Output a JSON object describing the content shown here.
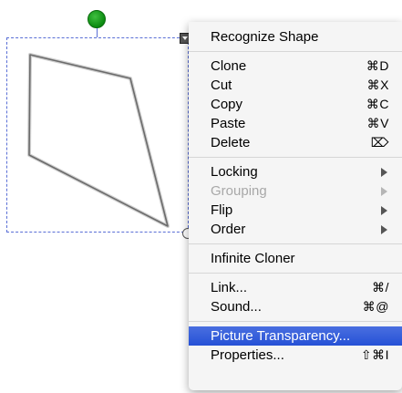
{
  "colors": {
    "selection_border": "#5a6fd6",
    "rotate_handle": "#0b8a10",
    "highlight": "#2d5bd9",
    "menu_background": "#f5f5f5"
  },
  "canvas": {
    "shape_type": "quadrilateral"
  },
  "menu": {
    "groups": [
      [
        {
          "label": "Recognize Shape",
          "shortcut": "",
          "submenu": false,
          "disabled": false,
          "highlighted": false
        }
      ],
      [
        {
          "label": "Clone",
          "shortcut": "⌘D",
          "submenu": false,
          "disabled": false,
          "highlighted": false
        },
        {
          "label": "Cut",
          "shortcut": "⌘X",
          "submenu": false,
          "disabled": false,
          "highlighted": false
        },
        {
          "label": "Copy",
          "shortcut": "⌘C",
          "submenu": false,
          "disabled": false,
          "highlighted": false
        },
        {
          "label": "Paste",
          "shortcut": "⌘V",
          "submenu": false,
          "disabled": false,
          "highlighted": false
        },
        {
          "label": "Delete",
          "shortcut": "⌦",
          "submenu": false,
          "disabled": false,
          "highlighted": false
        }
      ],
      [
        {
          "label": "Locking",
          "shortcut": "",
          "submenu": true,
          "disabled": false,
          "highlighted": false
        },
        {
          "label": "Grouping",
          "shortcut": "",
          "submenu": true,
          "disabled": true,
          "highlighted": false
        },
        {
          "label": "Flip",
          "shortcut": "",
          "submenu": true,
          "disabled": false,
          "highlighted": false
        },
        {
          "label": "Order",
          "shortcut": "",
          "submenu": true,
          "disabled": false,
          "highlighted": false
        }
      ],
      [
        {
          "label": "Infinite Cloner",
          "shortcut": "",
          "submenu": false,
          "disabled": false,
          "highlighted": false
        }
      ],
      [
        {
          "label": "Link...",
          "shortcut": "⌘/",
          "submenu": false,
          "disabled": false,
          "highlighted": false
        },
        {
          "label": "Sound...",
          "shortcut": "⌘@",
          "submenu": false,
          "disabled": false,
          "highlighted": false
        }
      ],
      [
        {
          "label": "Picture Transparency...",
          "shortcut": "",
          "submenu": false,
          "disabled": false,
          "highlighted": true
        },
        {
          "label": "Properties...",
          "shortcut": "⇧⌘I",
          "submenu": false,
          "disabled": false,
          "highlighted": false
        }
      ]
    ]
  }
}
